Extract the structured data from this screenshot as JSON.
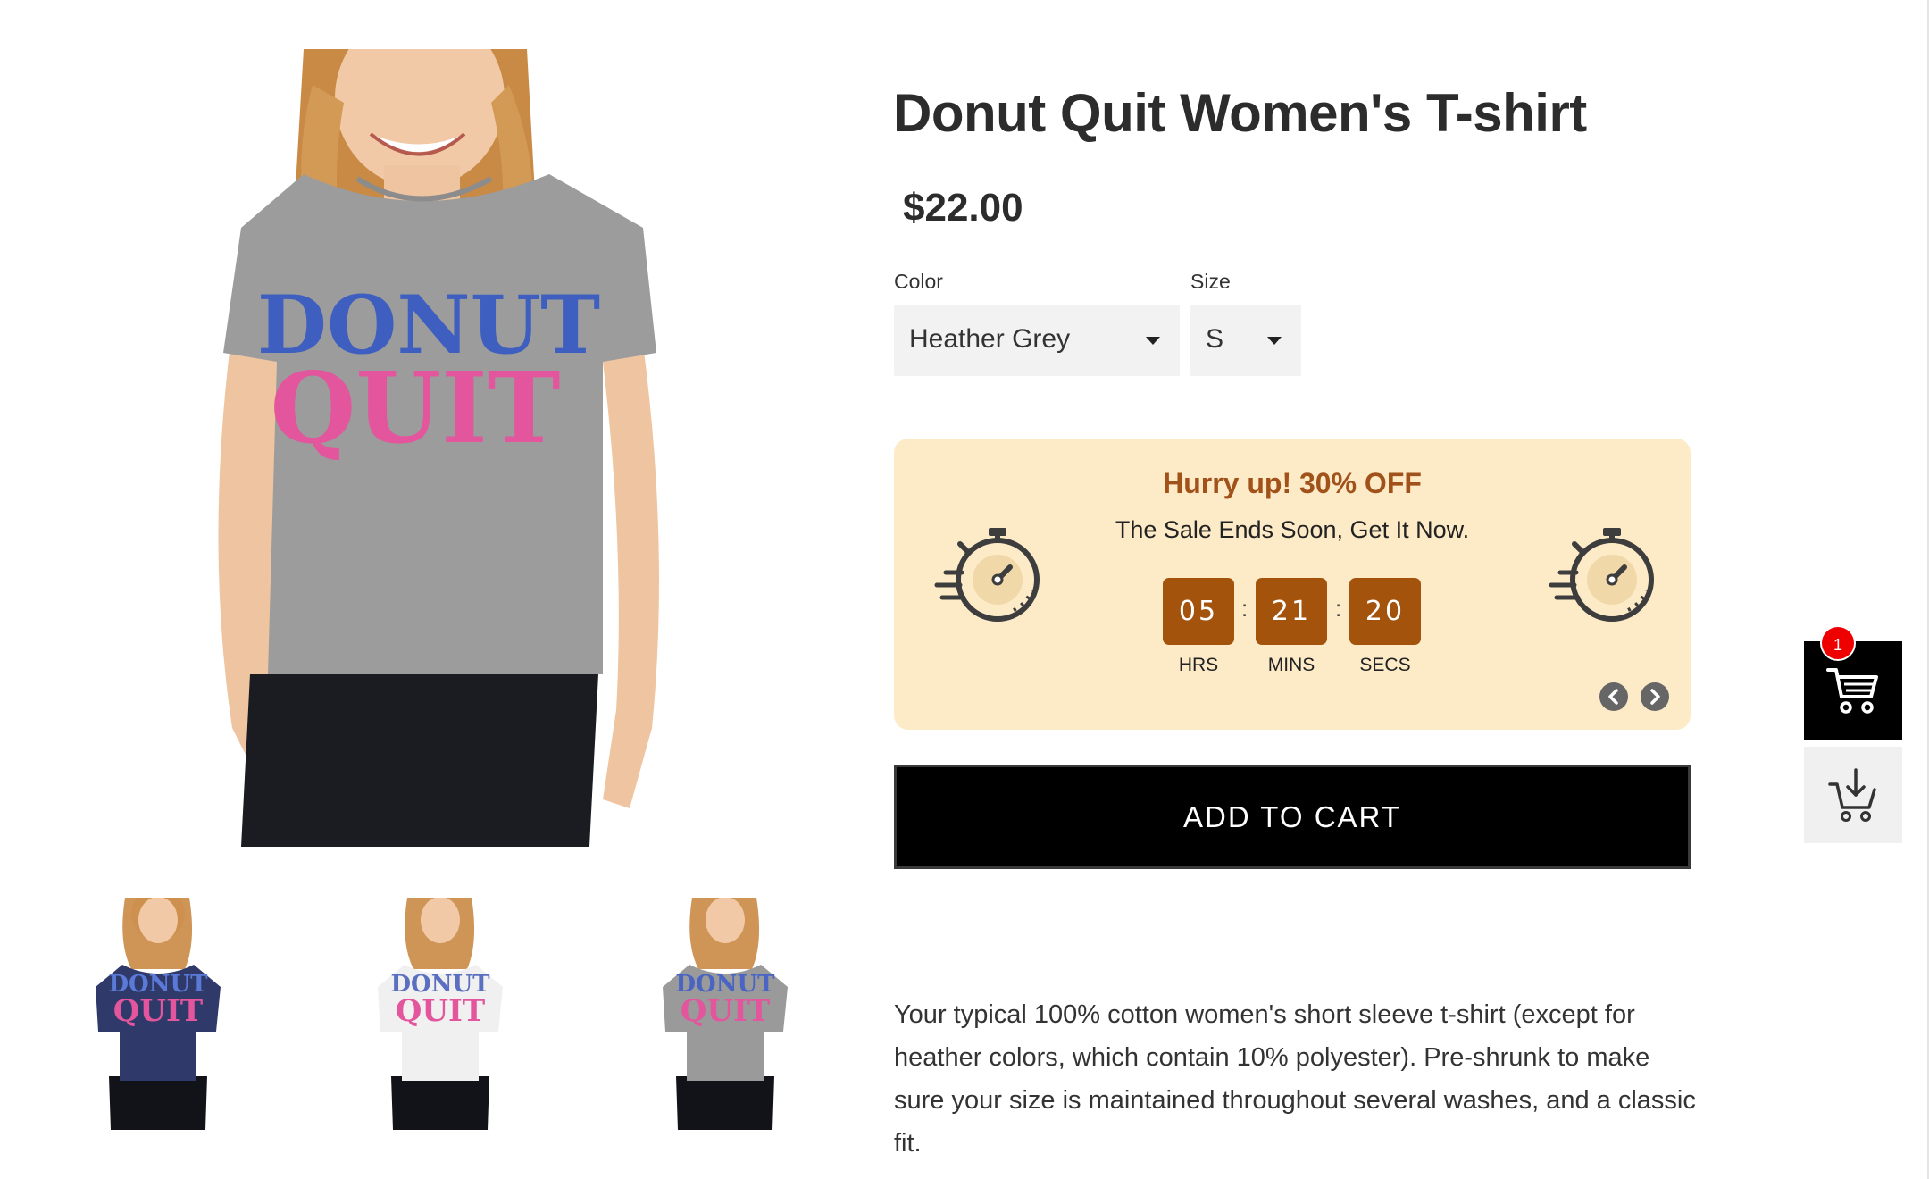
{
  "product": {
    "title": "Donut Quit Women's T-shirt",
    "price": "$22.00",
    "graphic_line1": "DONUT",
    "graphic_line2": "QUIT",
    "options": {
      "color_label": "Color",
      "color_value": "Heather Grey",
      "size_label": "Size",
      "size_value": "S"
    },
    "thumbnails": [
      {
        "shirt_color": "#2f3a6b",
        "alt": "Navy"
      },
      {
        "shirt_color": "#f2f2f2",
        "alt": "White"
      },
      {
        "shirt_color": "#9a9a9a",
        "alt": "Heather Grey"
      }
    ],
    "description": "Your typical 100% cotton women's short sleeve t-shirt (except for heather colors, which contain 10% polyester). Pre-shrunk to make sure your size is maintained throughout several washes, and a classic fit."
  },
  "sale": {
    "headline": "Hurry up! 30% OFF",
    "subtext": "The Sale Ends Soon, Get It Now.",
    "countdown": {
      "hours": "05",
      "minutes": "21",
      "seconds": "20",
      "hours_label": "HRS",
      "minutes_label": "MINS",
      "seconds_label": "SECS",
      "separator": ":"
    }
  },
  "add_to_cart_label": "ADD TO CART",
  "floating_cart": {
    "badge_count": "1"
  },
  "colors": {
    "sale_bg": "#fdebc8",
    "sale_accent": "#a4530d",
    "headline": "#a0521a",
    "badge": "#ee0000"
  }
}
